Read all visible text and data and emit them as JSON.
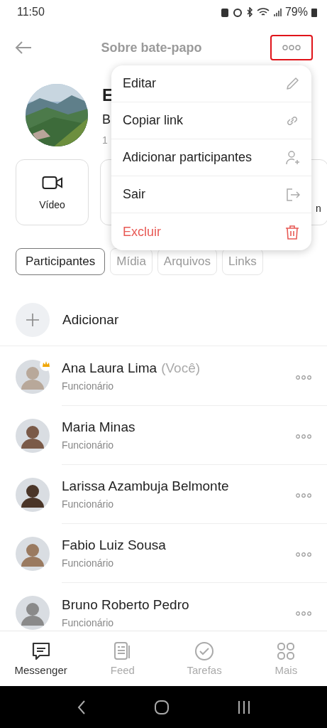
{
  "status_bar": {
    "time": "11:50",
    "battery": "79%"
  },
  "header": {
    "title": "Sobre bate-papo",
    "more_highlighted": true
  },
  "profile": {
    "name": "E",
    "subtitle": "B",
    "members": "1"
  },
  "action_cards": [
    {
      "kind": "video",
      "label": "Vídeo"
    },
    {
      "kind": "hidden"
    },
    {
      "kind": "partial",
      "label": "n"
    }
  ],
  "menu": [
    {
      "kind": "edit",
      "label": "Editar",
      "danger": false
    },
    {
      "kind": "link",
      "label": "Copiar link",
      "danger": false
    },
    {
      "kind": "add-user",
      "label": "Adicionar participantes",
      "danger": false
    },
    {
      "kind": "exit",
      "label": "Sair",
      "danger": false
    },
    {
      "kind": "delete",
      "label": "Excluir",
      "danger": true
    }
  ],
  "tabs": [
    {
      "label": "Participantes",
      "selected": true
    },
    {
      "label": "Mídia",
      "selected": false
    },
    {
      "label": "Arquivos",
      "selected": false
    },
    {
      "label": "Links",
      "selected": false
    }
  ],
  "add_label": "Adicionar",
  "participants": [
    {
      "name": "Ana Laura Lima",
      "suffix": "(Você)",
      "role": "Funcionário",
      "owner": true
    },
    {
      "name": "Maria Minas",
      "role": "Funcionário",
      "owner": false
    },
    {
      "name": "Larissa Azambuja Belmonte",
      "role": "Funcionário",
      "owner": false
    },
    {
      "name": "Fabio Luiz Sousa",
      "role": "Funcionário",
      "owner": false
    },
    {
      "name": "Bruno Roberto Pedro",
      "role": "Funcionário",
      "owner": false
    }
  ],
  "bottom_nav": [
    {
      "kind": "chat",
      "label": "Messenger",
      "selected": true
    },
    {
      "kind": "feed",
      "label": "Feed",
      "selected": false
    },
    {
      "kind": "tasks",
      "label": "Tarefas",
      "selected": false
    },
    {
      "kind": "more",
      "label": "Mais",
      "selected": false
    }
  ]
}
